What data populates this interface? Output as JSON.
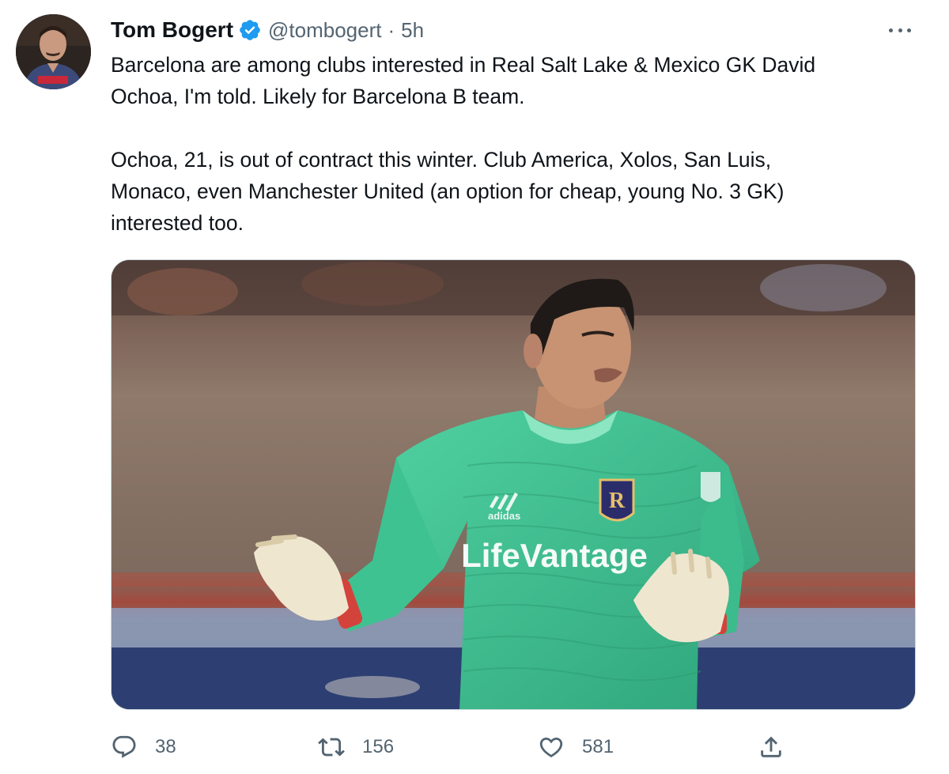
{
  "tweet": {
    "author": {
      "display_name": "Tom Bogert",
      "handle": "@tombogert",
      "separator": "·",
      "time": "5h",
      "verified_icon": "verified-badge-icon",
      "avatar": "profile-avatar"
    },
    "more_icon": "more-options-icon",
    "text_lines": [
      "Barcelona are among clubs interested in Real Salt Lake & Mexico GK David",
      "Ochoa, I'm told. Likely for Barcelona B team.",
      "Ochoa, 21, is out of contract this winter. Club America, Xolos, San Luis,",
      "Monaco, even Manchester United (an option for cheap, young No. 3 GK)",
      "interested too."
    ],
    "media": {
      "jersey_sponsor": "LifeVantage",
      "jersey_brand": "adidas",
      "crest_letter": "R",
      "colors": {
        "jersey": "#3fbf8f",
        "jersey_dark": "#2a9d73",
        "gloves": "#efe6cf",
        "background_wall": "#8a7466",
        "advertising_board": "#2d3f72"
      }
    },
    "actions": {
      "reply": {
        "icon": "reply-icon",
        "count": "38"
      },
      "retweet": {
        "icon": "retweet-icon",
        "count": "156"
      },
      "like": {
        "icon": "like-icon",
        "count": "581"
      },
      "share": {
        "icon": "share-icon"
      }
    },
    "colors": {
      "verified": "#1d9bf0",
      "secondary_text": "#536471",
      "primary_text": "#0f1419",
      "border": "#cfd9de"
    }
  }
}
